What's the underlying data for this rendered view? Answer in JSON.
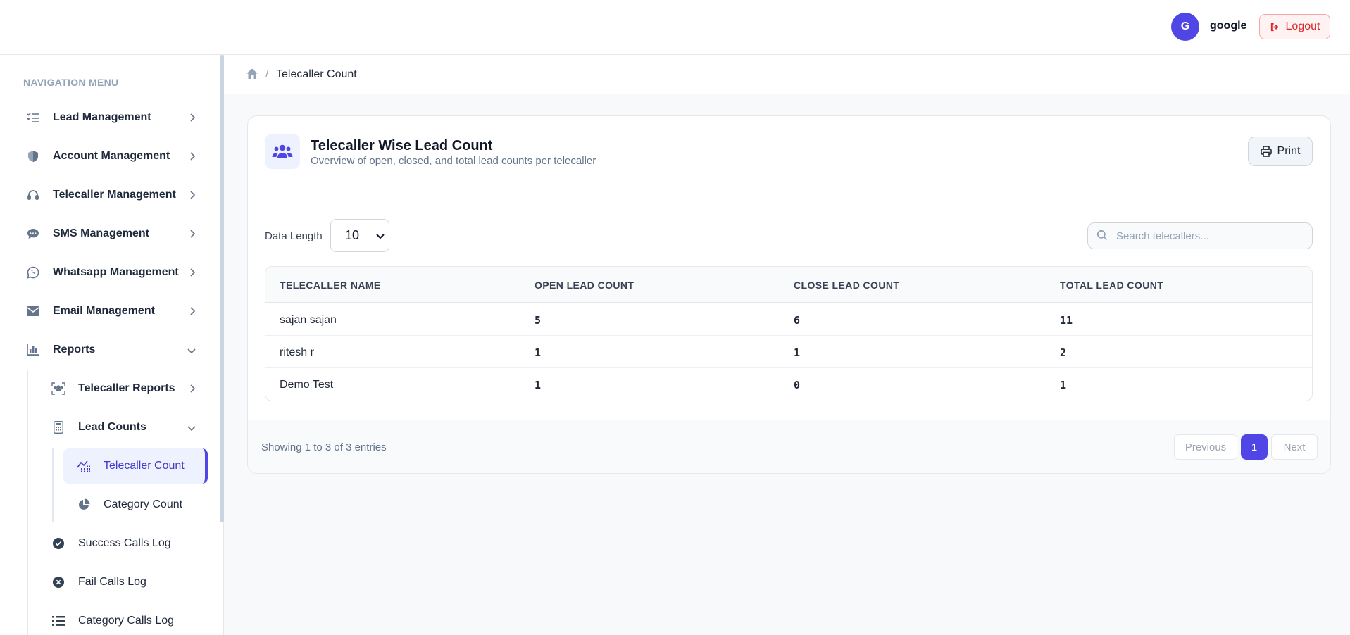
{
  "header": {
    "avatar_initial": "G",
    "username": "google",
    "logout_label": "Logout"
  },
  "sidebar": {
    "heading": "NAVIGATION MENU",
    "items": [
      {
        "label": "Lead Management",
        "icon": "list-check-icon"
      },
      {
        "label": "Account Management",
        "icon": "shield-icon"
      },
      {
        "label": "Telecaller Management",
        "icon": "headset-icon"
      },
      {
        "label": "SMS Management",
        "icon": "chat-bubble-icon"
      },
      {
        "label": "Whatsapp Management",
        "icon": "whatsapp-icon"
      },
      {
        "label": "Email Management",
        "icon": "envelope-icon"
      },
      {
        "label": "Reports",
        "icon": "bar-chart-icon"
      }
    ],
    "reports_children": [
      {
        "label": "Telecaller Reports",
        "icon": "users-scan-icon"
      },
      {
        "label": "Lead Counts",
        "icon": "calculator-icon"
      }
    ],
    "lead_counts_children": [
      {
        "label": "Telecaller Count",
        "icon": "chart-dots-icon"
      },
      {
        "label": "Category Count",
        "icon": "pie-chart-icon"
      }
    ],
    "more_reports": [
      {
        "label": "Success Calls Log",
        "icon": "check-circle-icon"
      },
      {
        "label": "Fail Calls Log",
        "icon": "x-circle-icon"
      },
      {
        "label": "Category Calls Log",
        "icon": "list-icon"
      }
    ]
  },
  "breadcrumb": {
    "current": "Telecaller Count"
  },
  "card": {
    "title": "Telecaller Wise Lead Count",
    "subtitle": "Overview of open, closed, and total lead counts per telecaller",
    "print_label": "Print",
    "data_length_label": "Data Length",
    "data_length_value": "10",
    "search_placeholder": "Search telecallers..."
  },
  "table": {
    "headers": [
      "TELECALLER NAME",
      "OPEN LEAD COUNT",
      "CLOSE LEAD COUNT",
      "TOTAL LEAD COUNT"
    ],
    "rows": [
      [
        "sajan sajan",
        "5",
        "6",
        "11"
      ],
      [
        "ritesh r",
        "1",
        "1",
        "2"
      ],
      [
        "Demo Test",
        "1",
        "0",
        "1"
      ]
    ]
  },
  "footer": {
    "info": "Showing 1 to 3 of 3 entries",
    "prev_label": "Previous",
    "page": "1",
    "next_label": "Next"
  },
  "colors": {
    "accent": "#4f46e5",
    "danger": "#dc2626"
  }
}
